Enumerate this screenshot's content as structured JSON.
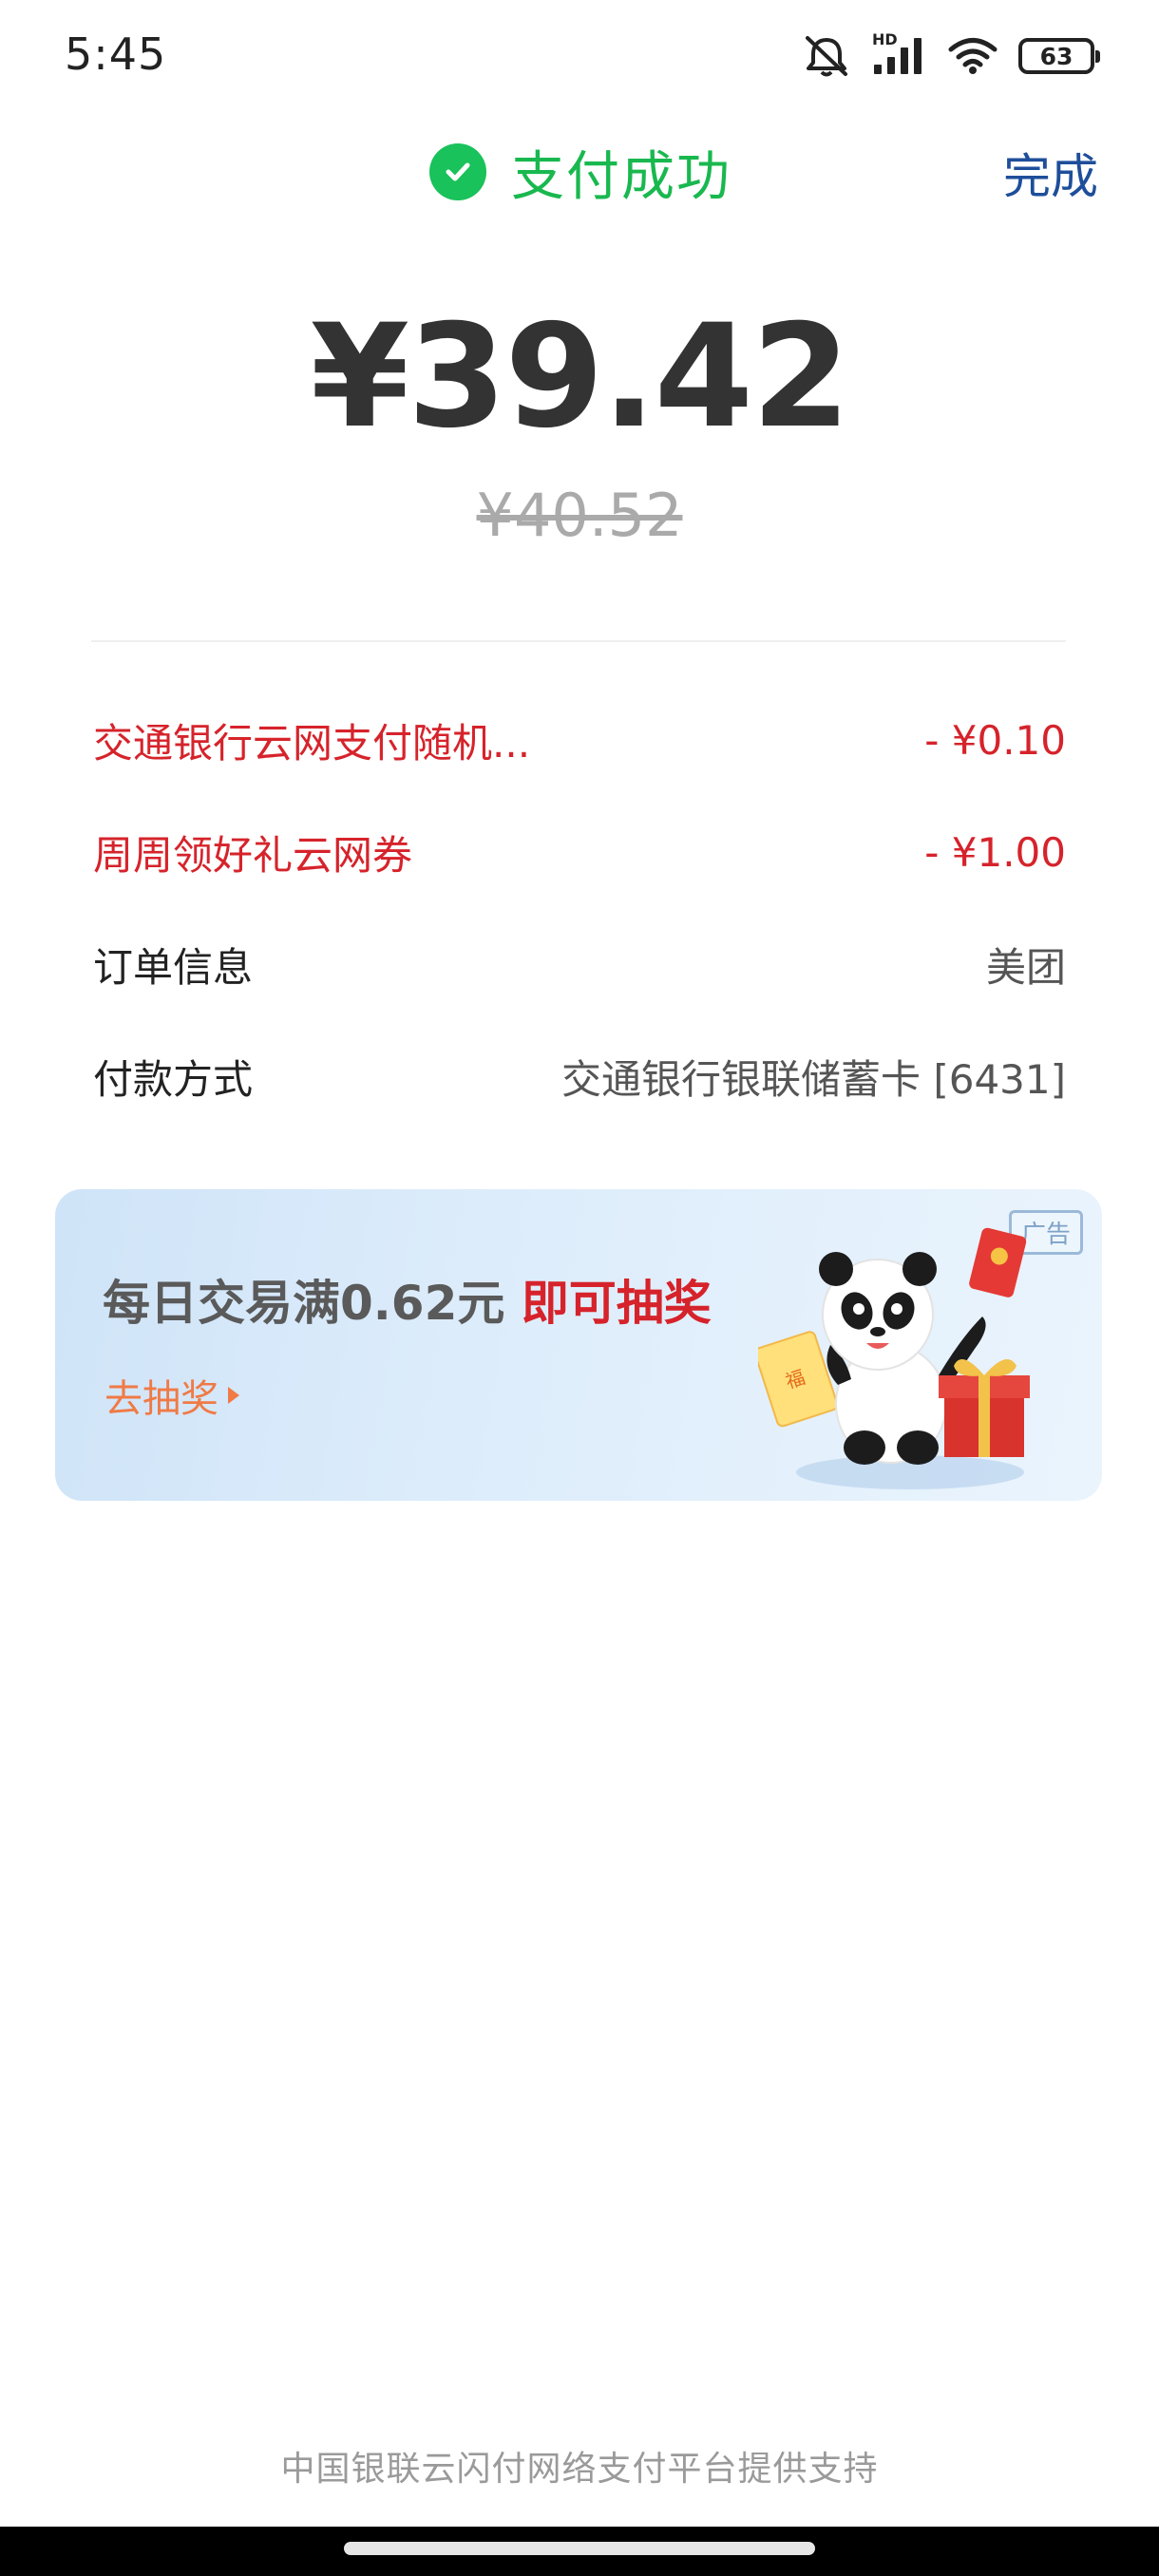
{
  "status_bar": {
    "time": "5:45",
    "network": "HD",
    "battery": "63",
    "icons": [
      "mute-icon",
      "signal-icon",
      "wifi-icon",
      "battery-icon"
    ]
  },
  "header": {
    "title": "支付成功",
    "done_label": "完成",
    "success_color": "#19b84f",
    "done_color": "#1e4e9a"
  },
  "payment": {
    "amount": "¥39.42",
    "original_amount": "¥40.52"
  },
  "rows": [
    {
      "label": "交通银行云网支付随机...",
      "value": "- ¥0.10"
    },
    {
      "label": "周周领好礼云网券",
      "value": "- ¥1.00"
    },
    {
      "label": "订单信息",
      "value": "美团"
    },
    {
      "label": "付款方式",
      "value": "交通银行银联储蓄卡 [6431]"
    }
  ],
  "ad": {
    "tag": "广告",
    "title": "每日交易满0.62元",
    "highlight": "即可抽奖",
    "cta": "去抽奖",
    "badge": "福"
  },
  "footer": {
    "text": "中国银联云闪付网络支付平台提供支持"
  },
  "colors": {
    "discount": "#d6232b",
    "ad_cta": "#f07a46"
  }
}
